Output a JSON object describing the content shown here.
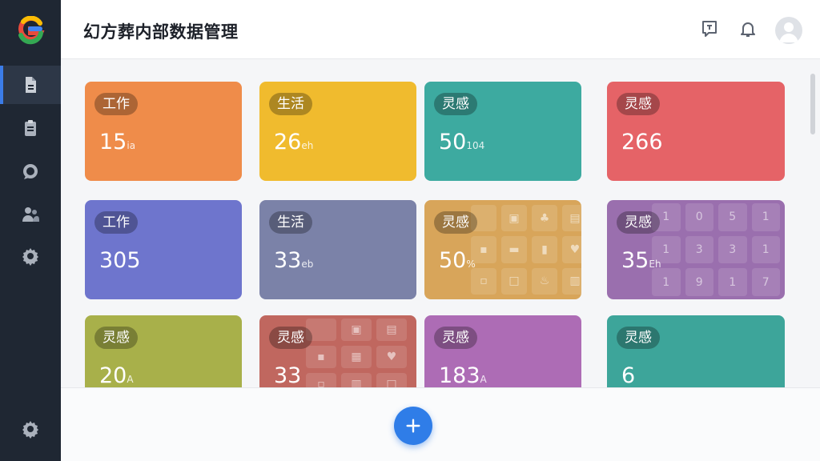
{
  "app": {
    "title": "幻方葬内部数据管理"
  },
  "colors": {
    "accent": "#2f7de8",
    "sidebar": "#1f2733"
  },
  "sidebar": {
    "items": [
      {
        "icon": "document-icon",
        "active": true
      },
      {
        "icon": "clipboard-icon",
        "active": false
      },
      {
        "icon": "chat-bubble-icon",
        "active": false
      },
      {
        "icon": "users-icon",
        "active": false
      },
      {
        "icon": "gear-icon",
        "active": false
      }
    ],
    "bottom_icon": "gear-icon"
  },
  "header": {
    "icons": [
      "message-icon",
      "bell-icon",
      "user-avatar-icon"
    ]
  },
  "cards": [
    {
      "tag": "工作",
      "number": "15",
      "suffix": "ia",
      "color": "#ef8c4a"
    },
    {
      "tag": "生活",
      "number": "26",
      "suffix": "eh",
      "color": "#f0bb2e"
    },
    {
      "tag": "灵感",
      "number": "50",
      "suffix": "104",
      "color": "#3daaa0"
    },
    {
      "tag": "灵感",
      "number": "266",
      "suffix": "",
      "color": "#e56367"
    },
    {
      "tag": "工作",
      "number": "305",
      "suffix": "",
      "color": "#6e75cd"
    },
    {
      "tag": "生活",
      "number": "33",
      "suffix": "eb",
      "color": "#7b82a8"
    },
    {
      "tag": "灵感",
      "number": "50",
      "suffix": "%",
      "color": "#d8a55a"
    },
    {
      "tag": "灵感",
      "number": "35",
      "suffix": "Eh",
      "color": "#9a6fae"
    },
    {
      "tag": "灵感",
      "number": "20",
      "suffix": "A",
      "color": "#a8b04a"
    },
    {
      "tag": "灵感",
      "number": "33",
      "suffix": "",
      "color": "#c0675f"
    },
    {
      "tag": "灵感",
      "number": "183",
      "suffix": "A",
      "color": "#ad6cb5"
    },
    {
      "tag": "灵感",
      "number": "6",
      "suffix": "",
      "color": "#3da59a"
    }
  ],
  "grid_digits": [
    "1",
    "0",
    "5",
    "1",
    "1",
    "3",
    "3",
    "1",
    "1",
    "9",
    "1",
    "7"
  ],
  "fab": {
    "label": "+",
    "icon": "plus-icon"
  }
}
